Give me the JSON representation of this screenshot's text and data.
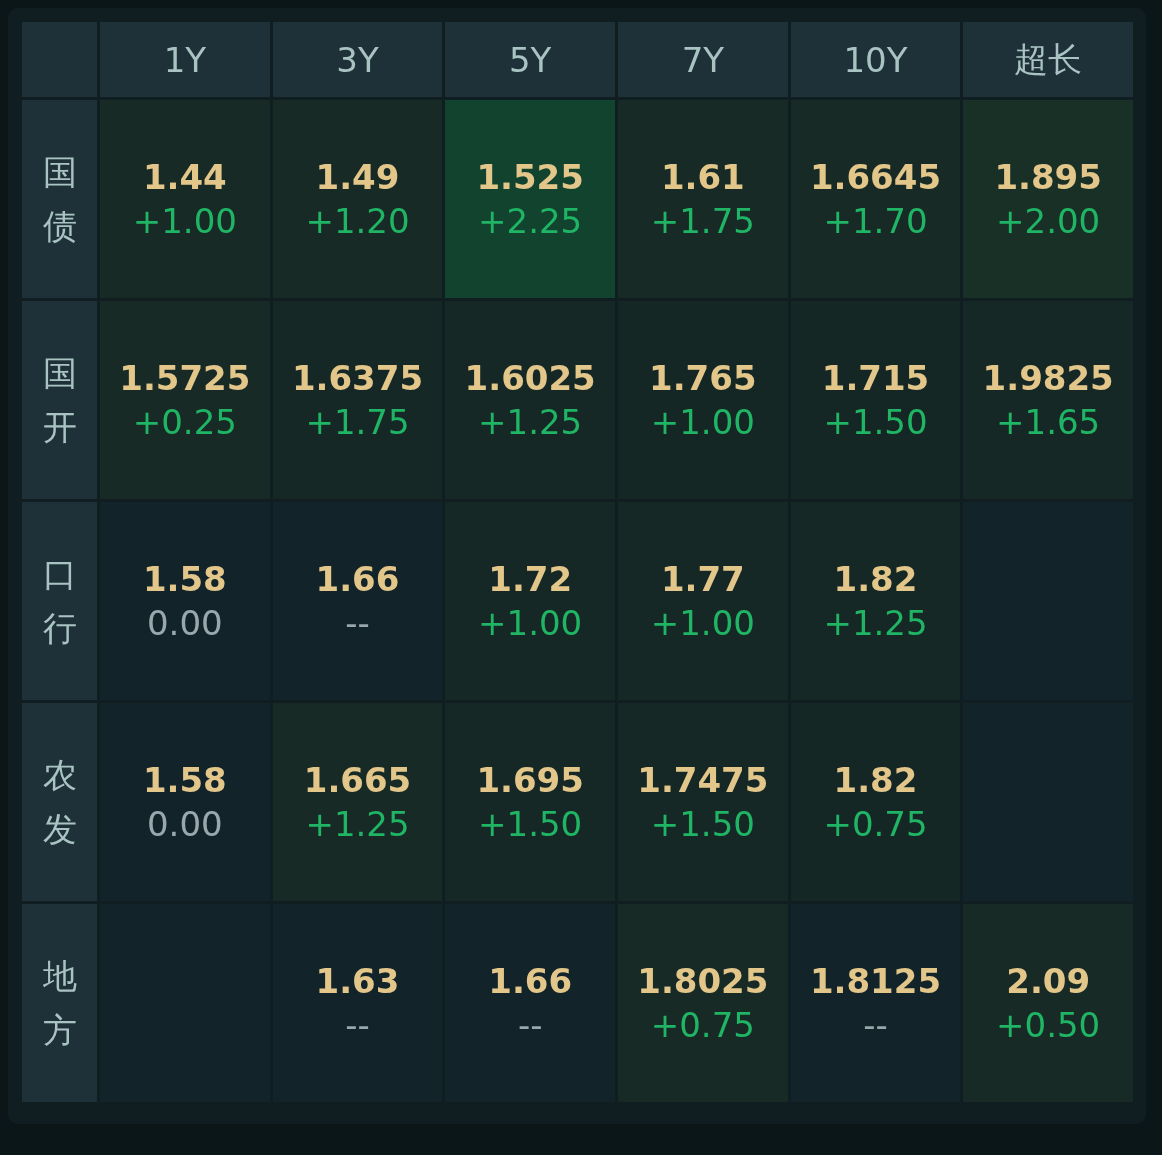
{
  "columns": [
    "1Y",
    "3Y",
    "5Y",
    "7Y",
    "10Y",
    "超长"
  ],
  "rows": [
    {
      "label": "国债",
      "cells": [
        {
          "yield": "1.44",
          "change": "+1.00",
          "kind": "up",
          "color": "#172a25"
        },
        {
          "yield": "1.49",
          "change": "+1.20",
          "kind": "up",
          "color": "#172a25"
        },
        {
          "yield": "1.525",
          "change": "+2.25",
          "kind": "up",
          "color": "#12432f"
        },
        {
          "yield": "1.61",
          "change": "+1.75",
          "kind": "up",
          "color": "#172a25"
        },
        {
          "yield": "1.6645",
          "change": "+1.70",
          "kind": "up",
          "color": "#172a25"
        },
        {
          "yield": "1.895",
          "change": "+2.00",
          "kind": "up",
          "color": "#193027"
        }
      ]
    },
    {
      "label": "国开",
      "cells": [
        {
          "yield": "1.5725",
          "change": "+0.25",
          "kind": "up",
          "color": "#172a25"
        },
        {
          "yield": "1.6375",
          "change": "+1.75",
          "kind": "up",
          "color": "#162825"
        },
        {
          "yield": "1.6025",
          "change": "+1.25",
          "kind": "up",
          "color": "#162825"
        },
        {
          "yield": "1.765",
          "change": "+1.00",
          "kind": "up",
          "color": "#152724"
        },
        {
          "yield": "1.715",
          "change": "+1.50",
          "kind": "up",
          "color": "#152724"
        },
        {
          "yield": "1.9825",
          "change": "+1.65",
          "kind": "up",
          "color": "#162825"
        }
      ]
    },
    {
      "label": "口行",
      "cells": [
        {
          "yield": "1.58",
          "change": "0.00",
          "kind": "flat",
          "color": "#13232a"
        },
        {
          "yield": "1.66",
          "change": "--",
          "kind": "flat",
          "color": "#13232a"
        },
        {
          "yield": "1.72",
          "change": "+1.00",
          "kind": "up",
          "color": "#162825"
        },
        {
          "yield": "1.77",
          "change": "+1.00",
          "kind": "up",
          "color": "#162825"
        },
        {
          "yield": "1.82",
          "change": "+1.25",
          "kind": "up",
          "color": "#162825"
        },
        {
          "color": "#13232a"
        }
      ]
    },
    {
      "label": "农发",
      "cells": [
        {
          "yield": "1.58",
          "change": "0.00",
          "kind": "flat",
          "color": "#13232a"
        },
        {
          "yield": "1.665",
          "change": "+1.25",
          "kind": "up",
          "color": "#172a25"
        },
        {
          "yield": "1.695",
          "change": "+1.50",
          "kind": "up",
          "color": "#162825"
        },
        {
          "yield": "1.7475",
          "change": "+1.50",
          "kind": "up",
          "color": "#162825"
        },
        {
          "yield": "1.82",
          "change": "+0.75",
          "kind": "up",
          "color": "#152724"
        },
        {
          "color": "#13232a"
        }
      ]
    },
    {
      "label": "地方",
      "cells": [
        {
          "color": "#13232a"
        },
        {
          "yield": "1.63",
          "change": "--",
          "kind": "flat",
          "color": "#13232a"
        },
        {
          "yield": "1.66",
          "change": "--",
          "kind": "flat",
          "color": "#13232a"
        },
        {
          "yield": "1.8025",
          "change": "+0.75",
          "kind": "up",
          "color": "#172a25"
        },
        {
          "yield": "1.8125",
          "change": "--",
          "kind": "flat",
          "color": "#13232a"
        },
        {
          "yield": "2.09",
          "change": "+0.50",
          "kind": "up",
          "color": "#172a25"
        }
      ]
    }
  ]
}
